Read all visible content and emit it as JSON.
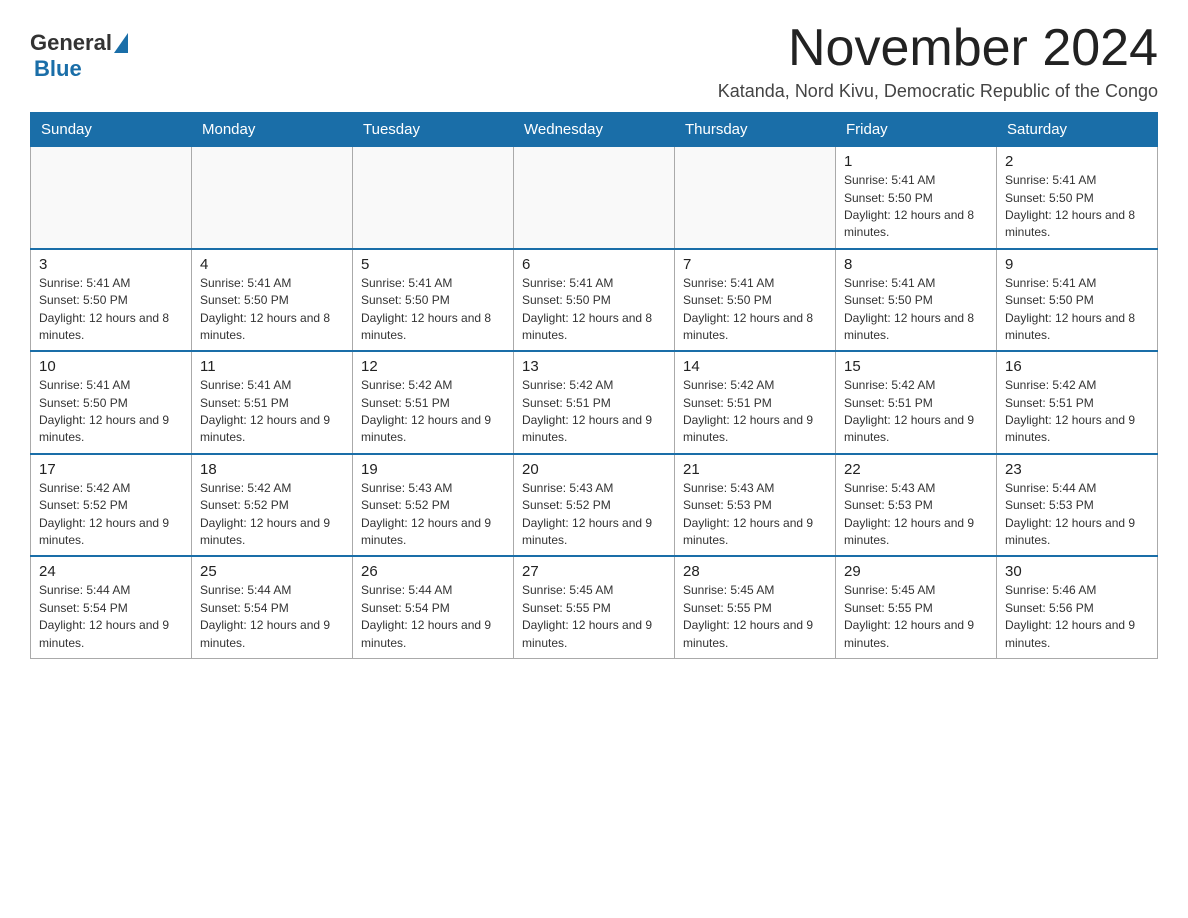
{
  "header": {
    "logo_general": "General",
    "logo_blue": "Blue",
    "month_title": "November 2024",
    "location": "Katanda, Nord Kivu, Democratic Republic of the Congo"
  },
  "days_of_week": [
    "Sunday",
    "Monday",
    "Tuesday",
    "Wednesday",
    "Thursday",
    "Friday",
    "Saturday"
  ],
  "weeks": [
    [
      {
        "day": "",
        "info": ""
      },
      {
        "day": "",
        "info": ""
      },
      {
        "day": "",
        "info": ""
      },
      {
        "day": "",
        "info": ""
      },
      {
        "day": "",
        "info": ""
      },
      {
        "day": "1",
        "info": "Sunrise: 5:41 AM\nSunset: 5:50 PM\nDaylight: 12 hours and 8 minutes."
      },
      {
        "day": "2",
        "info": "Sunrise: 5:41 AM\nSunset: 5:50 PM\nDaylight: 12 hours and 8 minutes."
      }
    ],
    [
      {
        "day": "3",
        "info": "Sunrise: 5:41 AM\nSunset: 5:50 PM\nDaylight: 12 hours and 8 minutes."
      },
      {
        "day": "4",
        "info": "Sunrise: 5:41 AM\nSunset: 5:50 PM\nDaylight: 12 hours and 8 minutes."
      },
      {
        "day": "5",
        "info": "Sunrise: 5:41 AM\nSunset: 5:50 PM\nDaylight: 12 hours and 8 minutes."
      },
      {
        "day": "6",
        "info": "Sunrise: 5:41 AM\nSunset: 5:50 PM\nDaylight: 12 hours and 8 minutes."
      },
      {
        "day": "7",
        "info": "Sunrise: 5:41 AM\nSunset: 5:50 PM\nDaylight: 12 hours and 8 minutes."
      },
      {
        "day": "8",
        "info": "Sunrise: 5:41 AM\nSunset: 5:50 PM\nDaylight: 12 hours and 8 minutes."
      },
      {
        "day": "9",
        "info": "Sunrise: 5:41 AM\nSunset: 5:50 PM\nDaylight: 12 hours and 8 minutes."
      }
    ],
    [
      {
        "day": "10",
        "info": "Sunrise: 5:41 AM\nSunset: 5:50 PM\nDaylight: 12 hours and 9 minutes."
      },
      {
        "day": "11",
        "info": "Sunrise: 5:41 AM\nSunset: 5:51 PM\nDaylight: 12 hours and 9 minutes."
      },
      {
        "day": "12",
        "info": "Sunrise: 5:42 AM\nSunset: 5:51 PM\nDaylight: 12 hours and 9 minutes."
      },
      {
        "day": "13",
        "info": "Sunrise: 5:42 AM\nSunset: 5:51 PM\nDaylight: 12 hours and 9 minutes."
      },
      {
        "day": "14",
        "info": "Sunrise: 5:42 AM\nSunset: 5:51 PM\nDaylight: 12 hours and 9 minutes."
      },
      {
        "day": "15",
        "info": "Sunrise: 5:42 AM\nSunset: 5:51 PM\nDaylight: 12 hours and 9 minutes."
      },
      {
        "day": "16",
        "info": "Sunrise: 5:42 AM\nSunset: 5:51 PM\nDaylight: 12 hours and 9 minutes."
      }
    ],
    [
      {
        "day": "17",
        "info": "Sunrise: 5:42 AM\nSunset: 5:52 PM\nDaylight: 12 hours and 9 minutes."
      },
      {
        "day": "18",
        "info": "Sunrise: 5:42 AM\nSunset: 5:52 PM\nDaylight: 12 hours and 9 minutes."
      },
      {
        "day": "19",
        "info": "Sunrise: 5:43 AM\nSunset: 5:52 PM\nDaylight: 12 hours and 9 minutes."
      },
      {
        "day": "20",
        "info": "Sunrise: 5:43 AM\nSunset: 5:52 PM\nDaylight: 12 hours and 9 minutes."
      },
      {
        "day": "21",
        "info": "Sunrise: 5:43 AM\nSunset: 5:53 PM\nDaylight: 12 hours and 9 minutes."
      },
      {
        "day": "22",
        "info": "Sunrise: 5:43 AM\nSunset: 5:53 PM\nDaylight: 12 hours and 9 minutes."
      },
      {
        "day": "23",
        "info": "Sunrise: 5:44 AM\nSunset: 5:53 PM\nDaylight: 12 hours and 9 minutes."
      }
    ],
    [
      {
        "day": "24",
        "info": "Sunrise: 5:44 AM\nSunset: 5:54 PM\nDaylight: 12 hours and 9 minutes."
      },
      {
        "day": "25",
        "info": "Sunrise: 5:44 AM\nSunset: 5:54 PM\nDaylight: 12 hours and 9 minutes."
      },
      {
        "day": "26",
        "info": "Sunrise: 5:44 AM\nSunset: 5:54 PM\nDaylight: 12 hours and 9 minutes."
      },
      {
        "day": "27",
        "info": "Sunrise: 5:45 AM\nSunset: 5:55 PM\nDaylight: 12 hours and 9 minutes."
      },
      {
        "day": "28",
        "info": "Sunrise: 5:45 AM\nSunset: 5:55 PM\nDaylight: 12 hours and 9 minutes."
      },
      {
        "day": "29",
        "info": "Sunrise: 5:45 AM\nSunset: 5:55 PM\nDaylight: 12 hours and 9 minutes."
      },
      {
        "day": "30",
        "info": "Sunrise: 5:46 AM\nSunset: 5:56 PM\nDaylight: 12 hours and 9 minutes."
      }
    ]
  ]
}
